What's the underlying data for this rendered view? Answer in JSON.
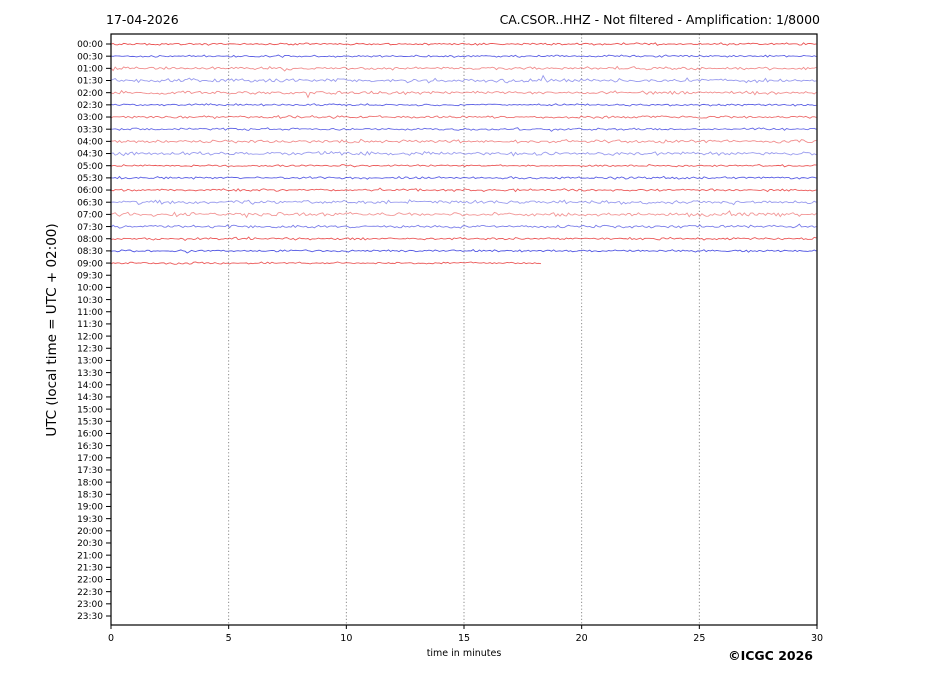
{
  "chart_data": {
    "type": "line",
    "subtype": "helicorder-seismogram",
    "title_left": "17-04-2026",
    "title_right": "CA.CSOR..HHZ - Not filtered - Amplification: 1/8000",
    "xlabel": "time in minutes",
    "ylabel": "UTC (local time = UTC + 02:00)",
    "copyright": "©ICGC 2026",
    "xlim": [
      0,
      30
    ],
    "x_ticks": [
      0,
      5,
      10,
      15,
      20,
      25,
      30
    ],
    "grid_x_minutes": [
      5,
      10,
      15,
      20,
      25
    ],
    "grid_on": true,
    "legend": "none",
    "colors": {
      "red": "#e63030",
      "blue": "#3338dd",
      "grid": "#808080",
      "frame": "#000000"
    },
    "rows": [
      {
        "time": "00:00",
        "trace": true,
        "color": "red",
        "start": 0,
        "end": 30,
        "amp": 0.7,
        "opacity": 0.85
      },
      {
        "time": "00:30",
        "trace": true,
        "color": "blue",
        "start": 0,
        "end": 30,
        "amp": 0.7,
        "opacity": 0.8
      },
      {
        "time": "01:00",
        "trace": true,
        "color": "red",
        "start": 0,
        "end": 30,
        "amp": 1.0,
        "opacity": 0.55
      },
      {
        "time": "01:30",
        "trace": true,
        "color": "blue",
        "start": 0,
        "end": 30,
        "amp": 1.3,
        "opacity": 0.5
      },
      {
        "time": "02:00",
        "trace": true,
        "color": "red",
        "start": 0,
        "end": 30,
        "amp": 1.1,
        "opacity": 0.55
      },
      {
        "time": "02:30",
        "trace": true,
        "color": "blue",
        "start": 0,
        "end": 30,
        "amp": 0.7,
        "opacity": 0.8
      },
      {
        "time": "03:00",
        "trace": true,
        "color": "red",
        "start": 0,
        "end": 30,
        "amp": 0.9,
        "opacity": 0.7
      },
      {
        "time": "03:30",
        "trace": true,
        "color": "blue",
        "start": 0,
        "end": 30,
        "amp": 0.8,
        "opacity": 0.75
      },
      {
        "time": "04:00",
        "trace": true,
        "color": "red",
        "start": 0,
        "end": 30,
        "amp": 1.1,
        "opacity": 0.55
      },
      {
        "time": "04:30",
        "trace": true,
        "color": "blue",
        "start": 0,
        "end": 30,
        "amp": 1.3,
        "opacity": 0.5
      },
      {
        "time": "05:00",
        "trace": true,
        "color": "red",
        "start": 0,
        "end": 30,
        "amp": 0.7,
        "opacity": 0.8
      },
      {
        "time": "05:30",
        "trace": true,
        "color": "blue",
        "start": 0,
        "end": 30,
        "amp": 0.8,
        "opacity": 0.8
      },
      {
        "time": "06:00",
        "trace": true,
        "color": "red",
        "start": 0,
        "end": 30,
        "amp": 0.8,
        "opacity": 0.8
      },
      {
        "time": "06:30",
        "trace": true,
        "color": "blue",
        "start": 0,
        "end": 30,
        "amp": 1.2,
        "opacity": 0.5
      },
      {
        "time": "07:00",
        "trace": true,
        "color": "red",
        "start": 0,
        "end": 30,
        "amp": 1.3,
        "opacity": 0.5
      },
      {
        "time": "07:30",
        "trace": true,
        "color": "blue",
        "start": 0,
        "end": 30,
        "amp": 1.0,
        "opacity": 0.65
      },
      {
        "time": "08:00",
        "trace": true,
        "color": "red",
        "start": 0,
        "end": 30,
        "amp": 0.8,
        "opacity": 0.8
      },
      {
        "time": "08:30",
        "trace": true,
        "color": "blue",
        "start": 0,
        "end": 30,
        "amp": 0.7,
        "opacity": 0.85
      },
      {
        "time": "09:00",
        "trace": true,
        "color": "red",
        "start": 0,
        "end": 18.3,
        "amp": 0.7,
        "opacity": 0.8
      },
      {
        "time": "09:30",
        "trace": false
      },
      {
        "time": "10:00",
        "trace": false
      },
      {
        "time": "10:30",
        "trace": false
      },
      {
        "time": "11:00",
        "trace": false
      },
      {
        "time": "11:30",
        "trace": false
      },
      {
        "time": "12:00",
        "trace": false
      },
      {
        "time": "12:30",
        "trace": false
      },
      {
        "time": "13:00",
        "trace": false
      },
      {
        "time": "13:30",
        "trace": false
      },
      {
        "time": "14:00",
        "trace": false
      },
      {
        "time": "14:30",
        "trace": false
      },
      {
        "time": "15:00",
        "trace": false
      },
      {
        "time": "15:30",
        "trace": false
      },
      {
        "time": "16:00",
        "trace": false
      },
      {
        "time": "16:30",
        "trace": false
      },
      {
        "time": "17:00",
        "trace": false
      },
      {
        "time": "17:30",
        "trace": false
      },
      {
        "time": "18:00",
        "trace": false
      },
      {
        "time": "18:30",
        "trace": false
      },
      {
        "time": "19:00",
        "trace": false
      },
      {
        "time": "19:30",
        "trace": false
      },
      {
        "time": "20:00",
        "trace": false
      },
      {
        "time": "20:30",
        "trace": false
      },
      {
        "time": "21:00",
        "trace": false
      },
      {
        "time": "21:30",
        "trace": false
      },
      {
        "time": "22:00",
        "trace": false
      },
      {
        "time": "22:30",
        "trace": false
      },
      {
        "time": "23:00",
        "trace": false
      },
      {
        "time": "23:30",
        "trace": false
      }
    ]
  }
}
